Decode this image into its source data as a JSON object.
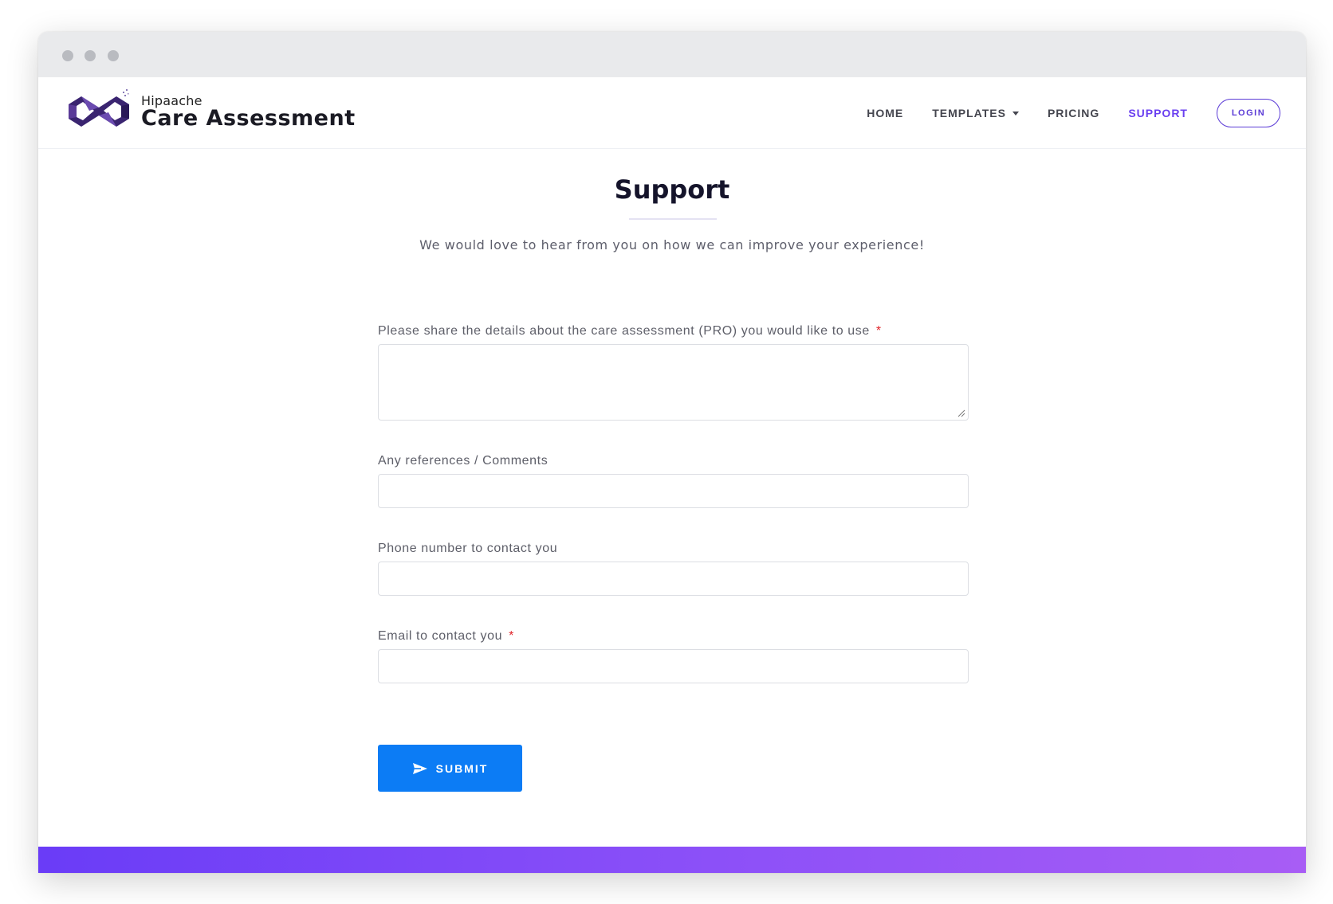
{
  "brand": {
    "small": "Hipaache",
    "big": "Care Assessment"
  },
  "nav": {
    "home": "HOME",
    "templates": "TEMPLATES",
    "pricing": "PRICING",
    "support": "SUPPORT",
    "login": "LOGIN"
  },
  "page": {
    "title": "Support",
    "subtitle": "We would love to hear from you on how we can improve your experience!"
  },
  "form": {
    "details_label": "Please share the details about the care assessment (PRO) you would like to use",
    "details_value": "",
    "comments_label": "Any references / Comments",
    "comments_value": "",
    "phone_label": "Phone number to contact you",
    "phone_value": "",
    "email_label": "Email to contact you",
    "email_value": "",
    "required_mark": "*",
    "submit_label": "SUBMIT"
  },
  "colors": {
    "accent": "#6a3ff0",
    "submit": "#0c7cf5",
    "required": "#e0242a",
    "footer_start": "#6a3cf7",
    "footer_end": "#a85df5"
  },
  "icons": {
    "logo": "infinity-mask-logo",
    "submit": "paper-plane-icon",
    "dropdown": "caret-down-icon"
  }
}
